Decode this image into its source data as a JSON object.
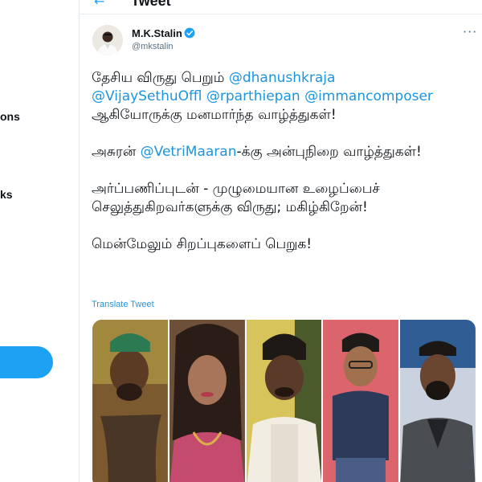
{
  "sidebar": {
    "frag_1": "ons",
    "frag_2": "ks"
  },
  "header": {
    "back_arrow": "←",
    "title": "Tweet"
  },
  "tweet": {
    "author_name": "M.K.Stalin",
    "handle": "@mkstalin",
    "more": "···",
    "p1_text1": "தேசிய விருது பெறும் ",
    "p1_mention1": "@dhanushkraja",
    "p1_mention2": "@VijaySethuOffl",
    "p1_space1": " ",
    "p1_mention3": "@rparthiepan",
    "p1_space2": " ",
    "p1_mention4": "@immancomposer",
    "p1_text2": "ஆகியோருக்கு மனமார்ந்த வாழ்த்துகள்!",
    "p2_text1": "அசுரன் ",
    "p2_mention": "@VetriMaaran",
    "p2_text2": "-க்கு அன்புநிறை வாழ்த்துகள்!",
    "p3_text": "அர்ப்பணிப்புடன் - முழுமையான உழைப்பைச் செலுத்துகிறவர்களுக்கு விருது; மகிழ்கிறேன்!",
    "p4_text": "மென்மேலும் சிறப்புகளைப் பெறுக!",
    "translate": "Translate Tweet"
  },
  "colors": {
    "twitter_blue": "#1da1f2",
    "link_blue": "#1b95e0"
  },
  "icons": {
    "back": "back-arrow-icon",
    "verified": "verified-badge-icon",
    "more": "more-icon"
  }
}
